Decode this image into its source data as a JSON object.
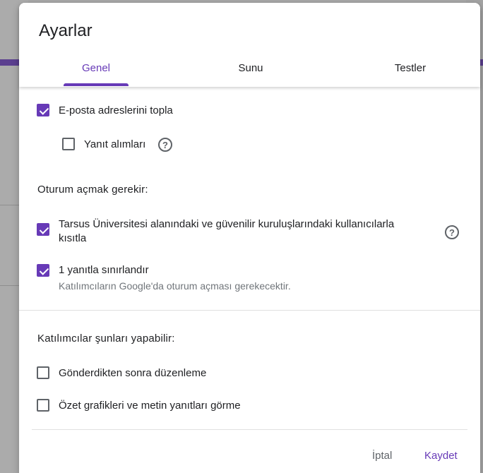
{
  "dialog": {
    "title": "Ayarlar",
    "tabs": [
      {
        "label": "Genel",
        "active": true
      },
      {
        "label": "Sunu",
        "active": false
      },
      {
        "label": "Testler",
        "active": false
      }
    ]
  },
  "general": {
    "collect_emails": {
      "label": "E-posta adreslerini topla",
      "checked": true
    },
    "response_receipts": {
      "label": "Yanıt alımları",
      "checked": false
    },
    "sign_in_section": {
      "title": "Oturum açmak gerekir:",
      "restrict_domain": {
        "label": "Tarsus Üniversitesi alanındaki ve güvenilir kuruluşlarındaki kullanıcılarla kısıtla",
        "checked": true
      },
      "limit_one": {
        "label": "1 yanıtla sınırlandır",
        "sublabel": "Katılımcıların Google'da oturum açması gerekecektir.",
        "checked": true
      }
    },
    "respondents_section": {
      "title": "Katılımcılar şunları yapabilir:",
      "edit_after_submit": {
        "label": "Gönderdikten sonra düzenleme",
        "checked": false
      },
      "see_summary": {
        "label": "Özet grafikleri ve metin yanıtları görme",
        "checked": false
      }
    }
  },
  "footer": {
    "cancel_label": "İptal",
    "save_label": "Kaydet"
  },
  "colors": {
    "accent": "#673ab7",
    "text": "#202124",
    "secondary_text": "#70757a",
    "divider": "#e0e0e0"
  },
  "icons": {
    "help": "help-circle-icon",
    "check": "check-icon"
  }
}
